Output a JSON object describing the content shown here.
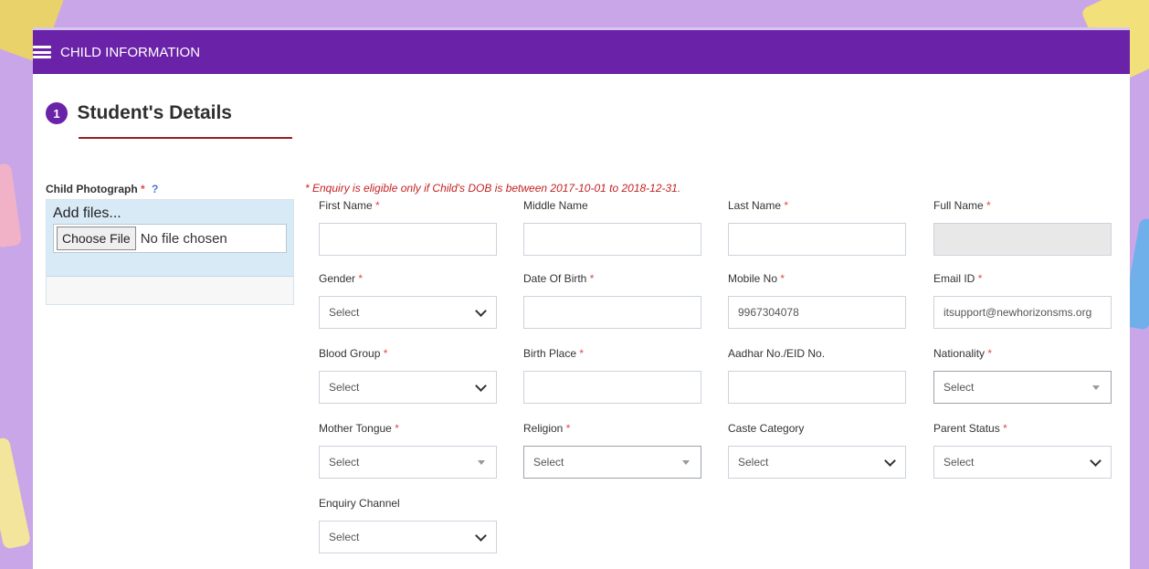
{
  "header": {
    "title": "CHILD INFORMATION"
  },
  "section": {
    "number": "1",
    "title": "Student's Details"
  },
  "photo": {
    "label": "Child Photograph",
    "required": "*",
    "help": "?",
    "add_files": "Add files...",
    "choose_file": "Choose File",
    "no_file": "No file chosen"
  },
  "eligibility_note": "* Enquiry is eligible only if Child's DOB is between 2017-10-01 to 2018-12-31.",
  "fields": {
    "first_name": {
      "label": "First Name",
      "value": ""
    },
    "middle_name": {
      "label": "Middle Name",
      "value": ""
    },
    "last_name": {
      "label": "Last Name",
      "value": ""
    },
    "full_name": {
      "label": "Full Name",
      "value": ""
    },
    "gender": {
      "label": "Gender",
      "value": "Select"
    },
    "dob": {
      "label": "Date Of Birth",
      "value": ""
    },
    "mobile": {
      "label": "Mobile No",
      "value": "9967304078"
    },
    "email": {
      "label": "Email ID",
      "value": "itsupport@newhorizonsms.org"
    },
    "blood_group": {
      "label": "Blood Group",
      "value": "Select"
    },
    "birth_place": {
      "label": "Birth Place",
      "value": ""
    },
    "aadhar": {
      "label": "Aadhar No./EID No.",
      "value": ""
    },
    "nationality": {
      "label": "Nationality",
      "value": "Select"
    },
    "mother_tongue": {
      "label": "Mother Tongue",
      "value": "Select"
    },
    "religion": {
      "label": "Religion",
      "value": "Select"
    },
    "caste": {
      "label": "Caste Category",
      "value": "Select"
    },
    "parent_status": {
      "label": "Parent Status",
      "value": "Select"
    },
    "enquiry_channel": {
      "label": "Enquiry Channel",
      "value": "Select"
    }
  },
  "required_marker": "*",
  "colors": {
    "header": "#6a22a8",
    "required": "#e04a4a",
    "underline": "#9b1c1c"
  }
}
